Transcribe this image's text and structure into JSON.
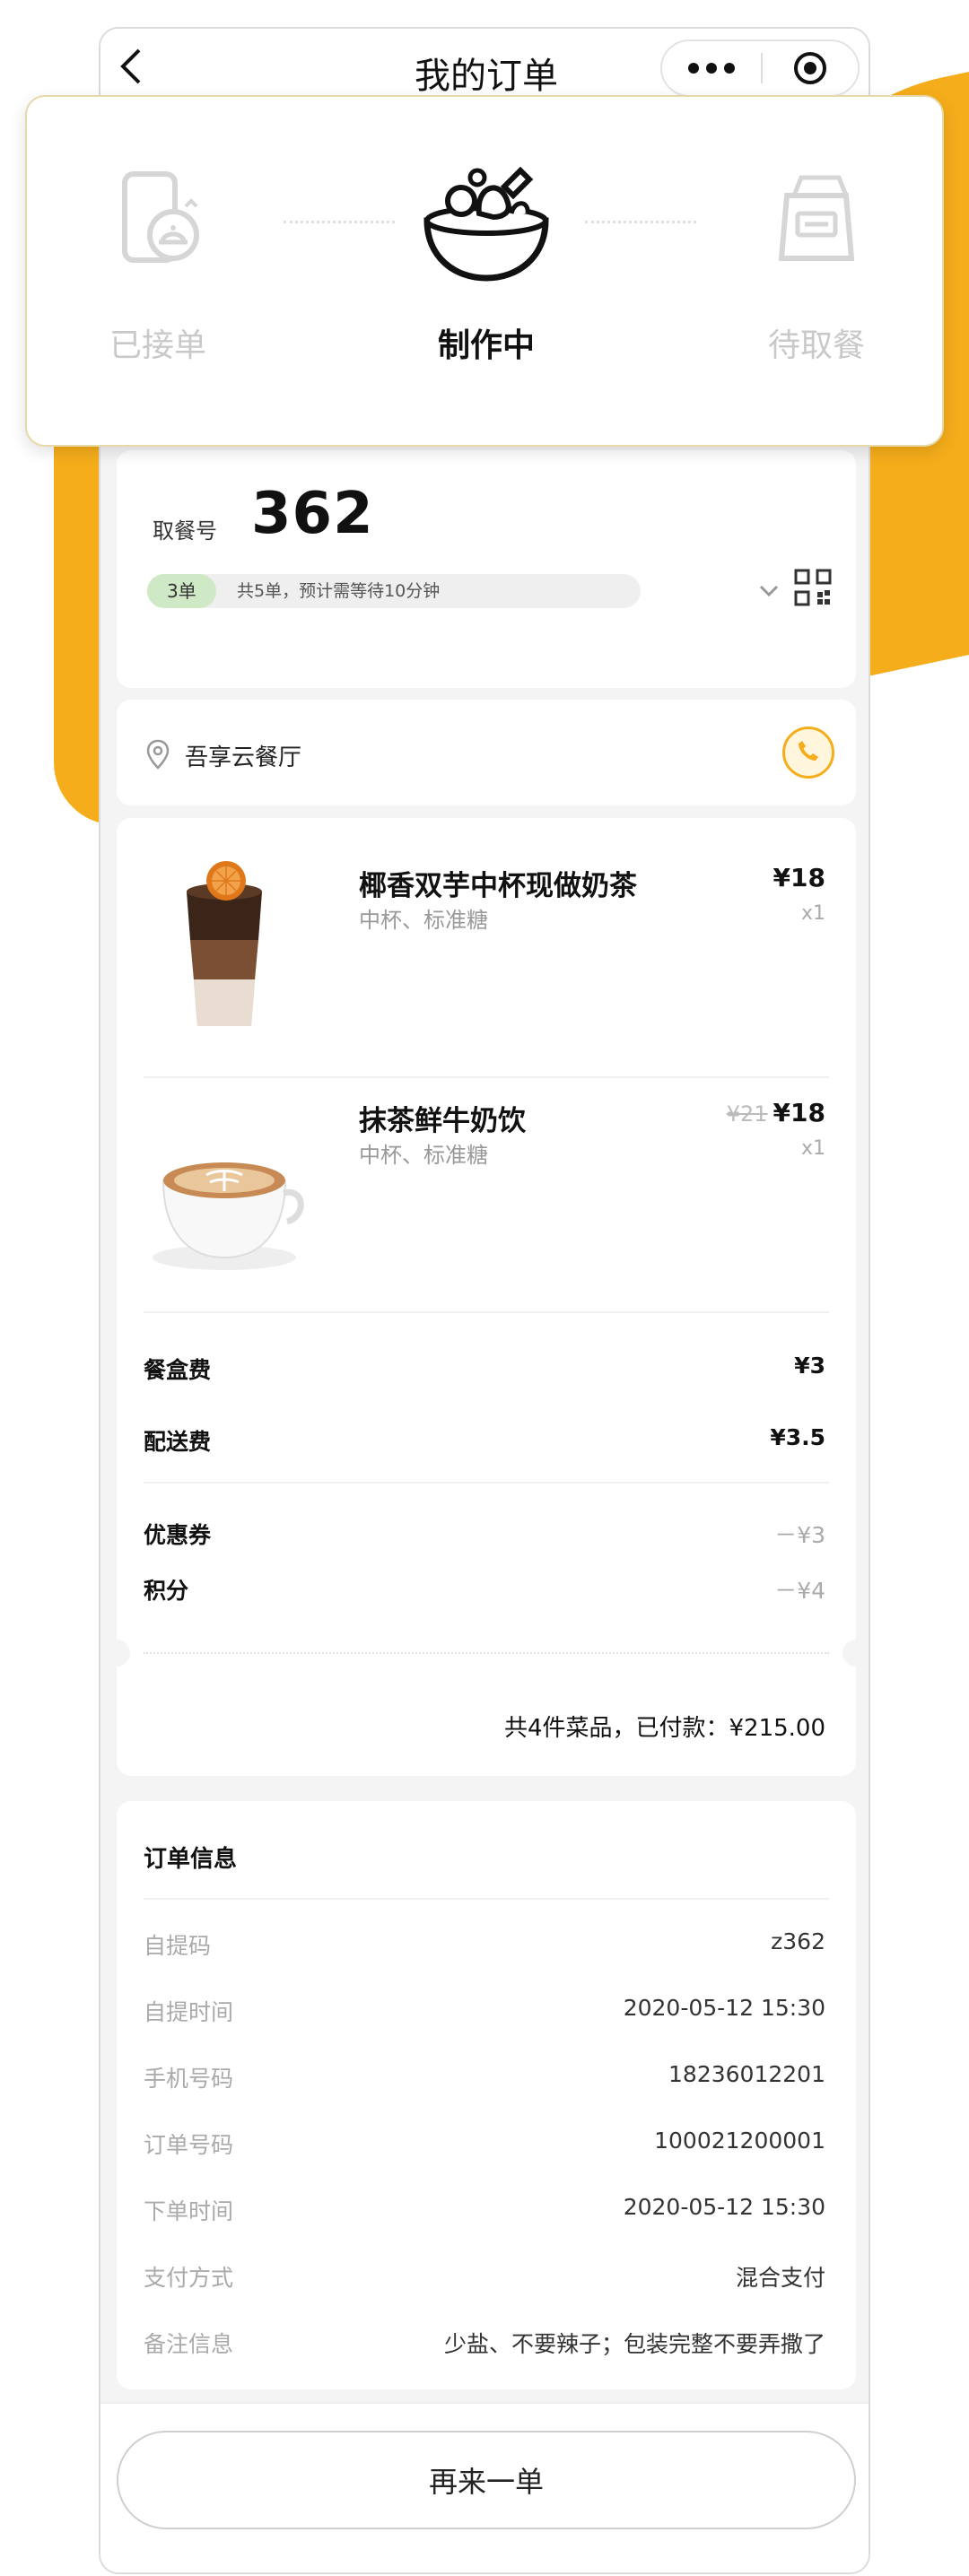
{
  "nav": {
    "title": "我的订单",
    "back_icon": "chevron-left-icon",
    "more_icon": "more-dots-icon",
    "target_icon": "target-icon"
  },
  "status": {
    "steps": [
      {
        "label": "已接单",
        "icon": "phone-order-icon",
        "state": "done"
      },
      {
        "label": "制作中",
        "icon": "food-bowl-icon",
        "state": "active"
      },
      {
        "label": "待取餐",
        "icon": "takeaway-bag-icon",
        "state": "pending"
      }
    ]
  },
  "pickup": {
    "label": "取餐号",
    "number": "362",
    "queue_chip": "3单",
    "queue_text": "共5单，预计需等待10分钟"
  },
  "store": {
    "name": "吾享云餐厅"
  },
  "items": [
    {
      "name": "椰香双芋中杯现做奶茶",
      "spec": "中杯、标准糖",
      "old_price": "",
      "price": "¥18",
      "qty": "x1"
    },
    {
      "name": "抹茶鲜牛奶饮",
      "spec": "中杯、标准糖",
      "old_price": "¥21",
      "price": "¥18",
      "qty": "x1"
    }
  ],
  "fees": [
    {
      "label": "餐盒费",
      "value": "¥3"
    },
    {
      "label": "配送费",
      "value": "¥3.5"
    }
  ],
  "discounts": [
    {
      "label": "优惠券",
      "value": "－¥3"
    },
    {
      "label": "积分",
      "value": "－¥4"
    }
  ],
  "total_text": "共4件菜品，已付款：¥215.00",
  "order_info": {
    "title": "订单信息",
    "rows": [
      {
        "label": "自提码",
        "value": "z362"
      },
      {
        "label": "自提时间",
        "value": "2020-05-12 15:30"
      },
      {
        "label": "手机号码",
        "value": "18236012201"
      },
      {
        "label": "订单号码",
        "value": "100021200001"
      },
      {
        "label": "下单时间",
        "value": "2020-05-12 15:30"
      },
      {
        "label": "支付方式",
        "value": "混合支付"
      },
      {
        "label": "备注信息",
        "value": "少盐、不要辣子；包装完整不要弄撒了"
      }
    ]
  },
  "reorder_label": "再来一单",
  "colors": {
    "accent": "#f5ad1b",
    "chip": "#cfe8c5"
  }
}
